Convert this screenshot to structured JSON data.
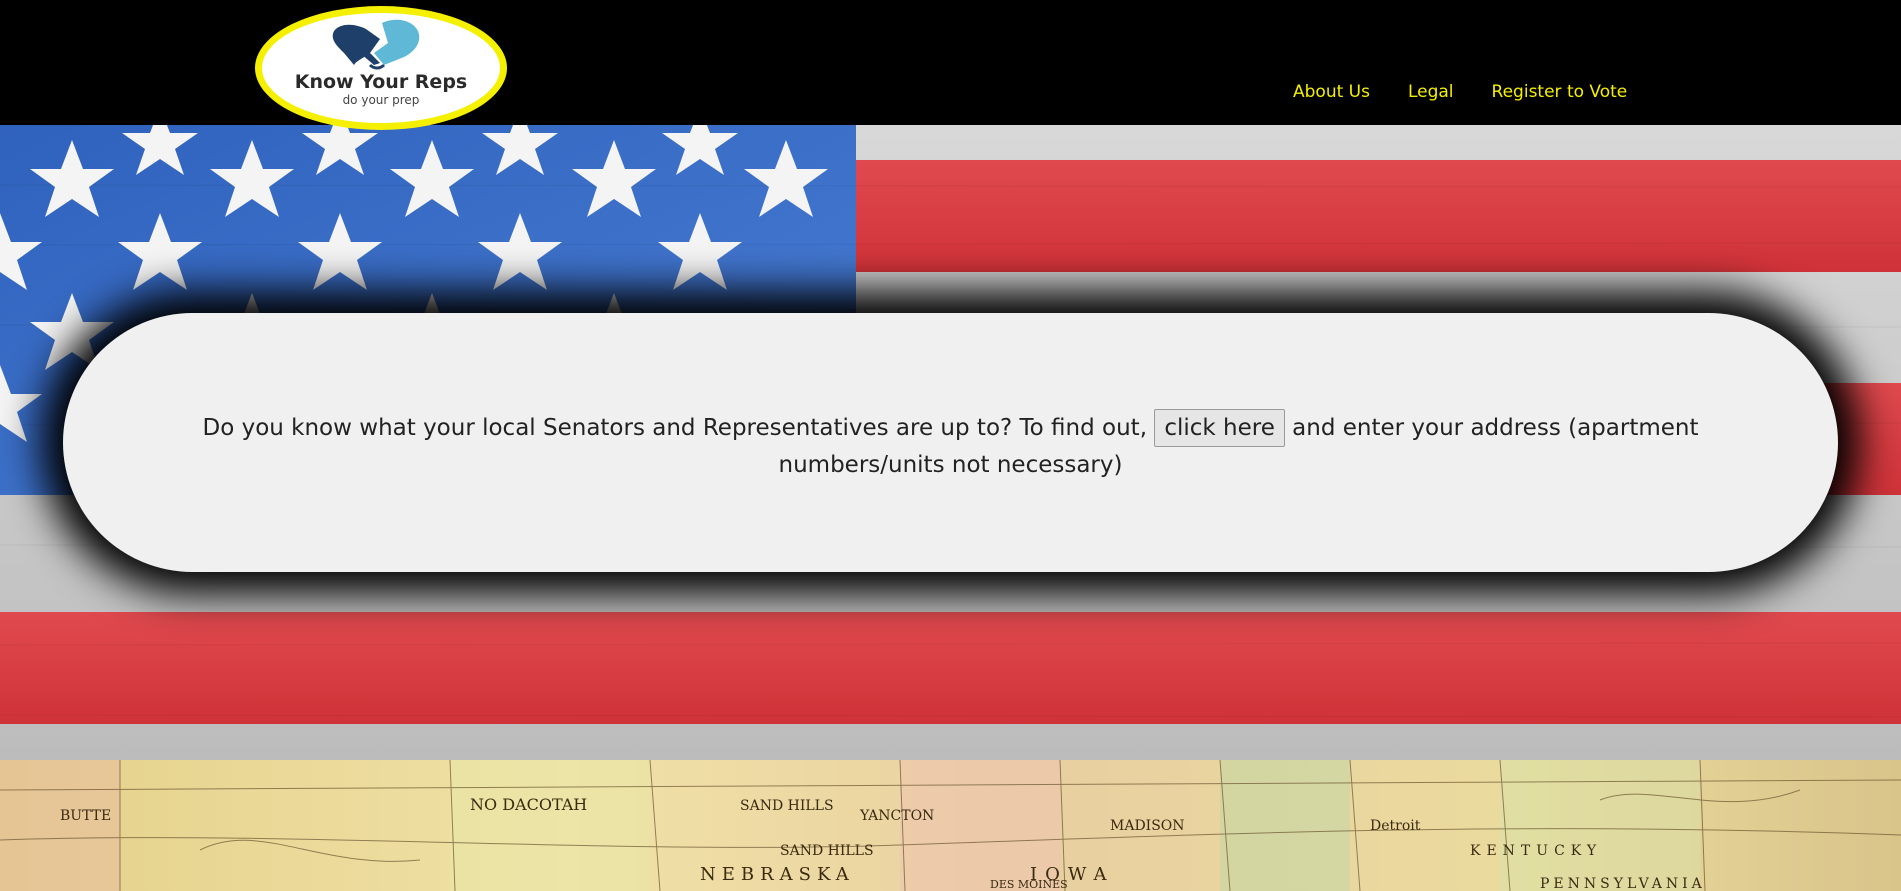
{
  "logo": {
    "title": "Know Your Reps",
    "tagline": "do your prep"
  },
  "nav": {
    "items": [
      {
        "label": "About Us"
      },
      {
        "label": "Legal"
      },
      {
        "label": "Register to Vote"
      }
    ]
  },
  "card": {
    "text_before": "Do you know what your local Senators and Representatives are up to? To find out, ",
    "button_label": "click here",
    "text_after": " and enter your address (apartment numbers/units not necessary)"
  },
  "map": {
    "labels": [
      "BUTTE",
      "NO DACOTAH",
      "SAND HILLS",
      "NEBRASKA",
      "YANCTON",
      "MADISON",
      "IOWA",
      "DES MOINES",
      "Detroit",
      "KENTUCKY",
      "PENNSYLVANIA",
      "SAND HILLS"
    ]
  },
  "colors": {
    "header_bg": "#000000",
    "nav_link": "#f5f000",
    "logo_border": "#f5f000",
    "card_bg": "#f0f0f0",
    "flag_red": "#d8363c",
    "flag_blue": "#3a6fc9"
  }
}
